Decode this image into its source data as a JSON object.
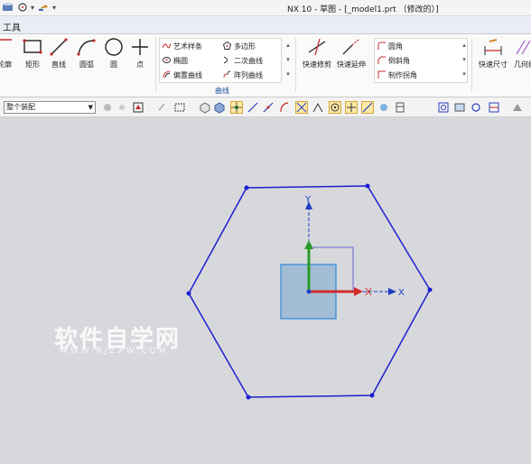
{
  "window": {
    "title": "NX 10 - 草图 - [_model1.prt （修改的）]",
    "quick_access": [
      "▾",
      "▾"
    ]
  },
  "tabs": {
    "tools": "工具"
  },
  "ribbon": {
    "buttons": {
      "profile": "轮廓",
      "rectangle": "矩形",
      "line": "直线",
      "arc": "圆弧",
      "circle": "圆",
      "point": "点"
    },
    "gallery": {
      "studio_spline": "艺术样条",
      "polygon": "多边形",
      "ellipse": "椭圆",
      "conic": "二次曲线",
      "offset_curve": "偏置曲线",
      "pattern_curve": "阵列曲线"
    },
    "group_label": "曲线",
    "edit": {
      "quick_trim": "快速修剪",
      "quick_extend": "快速延伸"
    },
    "corner": {
      "fillet": "圆角",
      "chamfer": "倒斜角",
      "make_corner": "制作拐角"
    },
    "dimension": {
      "rapid_dimension": "快速尺寸",
      "geometric": "几何约"
    }
  },
  "toolbar2": {
    "selection_filter": "整个装配"
  },
  "canvas": {
    "axis_x": "X",
    "axis_y": "Y"
  },
  "watermark": {
    "cn": "软件自学网",
    "en": "WWW.RJZXW.COM"
  },
  "colors": {
    "hexagon": "#1c1fd0",
    "canvas_bg": "#d7d8dc",
    "x_axis": "#d22b2b",
    "y_axis": "#2a9a2a",
    "datum_axis": "#1f3fc4",
    "csys_square": "#9ab8d4"
  }
}
